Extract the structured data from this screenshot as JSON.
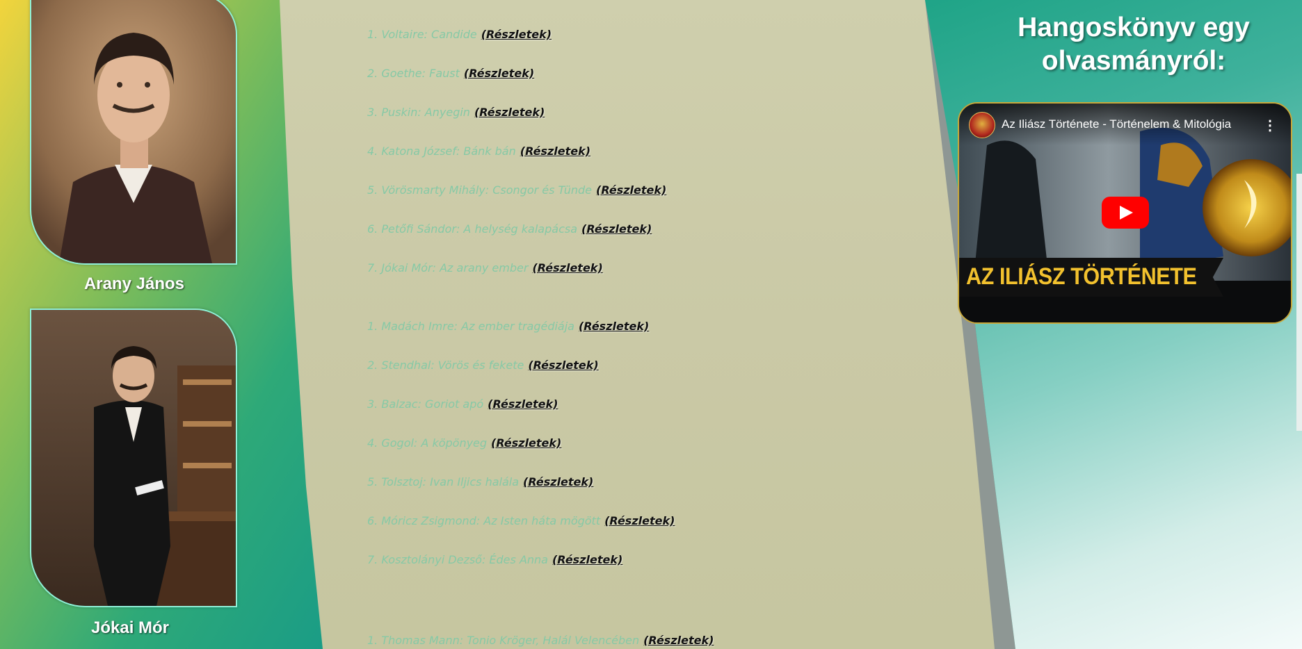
{
  "authors": [
    {
      "name": "Arany János",
      "portrait": "portrait of young man with moustache in dark coat"
    },
    {
      "name": "Jókai Mór",
      "portrait": "full-length portrait of man in black suit standing at desk"
    }
  ],
  "reading_list": {
    "link_label": "(Részletek)",
    "groups": [
      {
        "items": [
          {
            "text": "1. Voltaire: Candide"
          },
          {
            "text": "2. Goethe: Faust"
          },
          {
            "text": "3. Puskin: Anyegin"
          },
          {
            "text": "4. Katona József: Bánk bán"
          },
          {
            "text": "5. Vörösmarty Mihály: Csongor és Tünde"
          },
          {
            "text": "6. Petőfi Sándor: A helység kalapácsa"
          },
          {
            "text": "7. Jókai Mór: Az arany ember"
          }
        ]
      },
      {
        "items": [
          {
            "text": "1. Madách Imre: Az ember tragédiája"
          },
          {
            "text": "2. Stendhal: Vörös és fekete"
          },
          {
            "text": "3. Balzac: Goriot apó"
          },
          {
            "text": "4. Gogol: A köpönyeg"
          },
          {
            "text": "5. Tolsztoj: Ivan Iljics halála"
          },
          {
            "text": "6. Móricz Zsigmond: Az Isten háta mögött"
          },
          {
            "text": "7. Kosztolányi Dezső: Édes Anna"
          }
        ]
      },
      {
        "items": [
          {
            "text": "1. Thomas Mann: Tonio Kröger, Halál Velencében"
          }
        ]
      }
    ]
  },
  "sidebar": {
    "title": "Hangoskönyv egy olvasmányról:",
    "video": {
      "title": "Az Iliász Története - Történelem & Mitológia",
      "banner_text": "AZ ILIÁSZ TÖRTÉNETE",
      "play_icon": "youtube-play-icon",
      "menu_icon": "more-vert-icon"
    }
  },
  "colors": {
    "item_text": "#86c9a6",
    "link_text": "#111111",
    "paper": "#cfcfad",
    "play_button": "#ff0000",
    "banner_text": "#f2c12e"
  }
}
